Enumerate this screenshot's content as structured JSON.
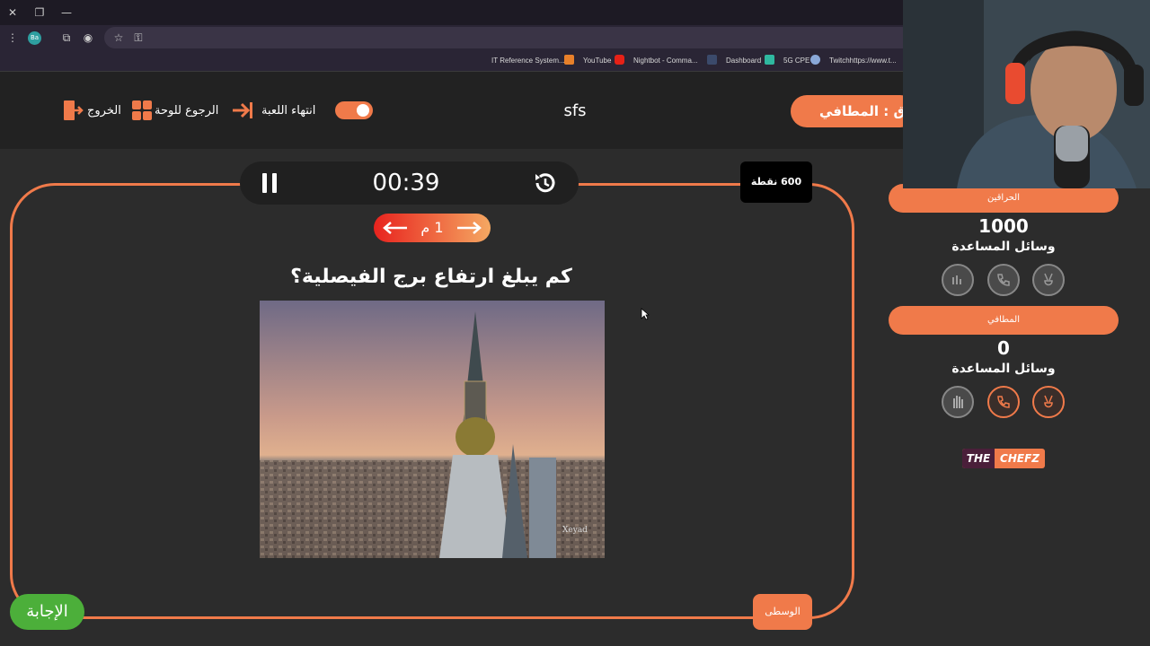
{
  "browser": {
    "profile_initials": "Ba",
    "bookmarks": [
      {
        "label": "IT Reference System..."
      },
      {
        "label": "YouTube"
      },
      {
        "label": "Nightbot - Comma..."
      },
      {
        "label": "Dashboard"
      },
      {
        "label": "5G CPE"
      },
      {
        "label": "Twitchhttps://www.t..."
      }
    ]
  },
  "header": {
    "exit_label": "الخروج",
    "back_label": "الرجوع للوحة",
    "end_game_label": "انتهاء اللعبة",
    "game_title": "sfs",
    "turn_label": "ق : المطافي"
  },
  "question_panel": {
    "timer": "00:39",
    "points": "600 نقطة",
    "round": "1 م",
    "question": "كم يبلغ ارتفاع برج الفيصلية؟",
    "photo_watermark": "Xeyad",
    "category": "الوسطى",
    "answer_label": "الإجابة"
  },
  "teams": [
    {
      "name": "الحراقين",
      "score": "1000",
      "aids_label": "وسائل المساعدة"
    },
    {
      "name": "المطافي",
      "score": "0",
      "aids_label": "وسائل المساعدة"
    }
  ],
  "logo": {
    "part1": "THE",
    "part2": "CHEFZ"
  },
  "colors": {
    "accent": "#f07a4a",
    "answer": "#4caf3a",
    "background": "#2c2c2c"
  }
}
